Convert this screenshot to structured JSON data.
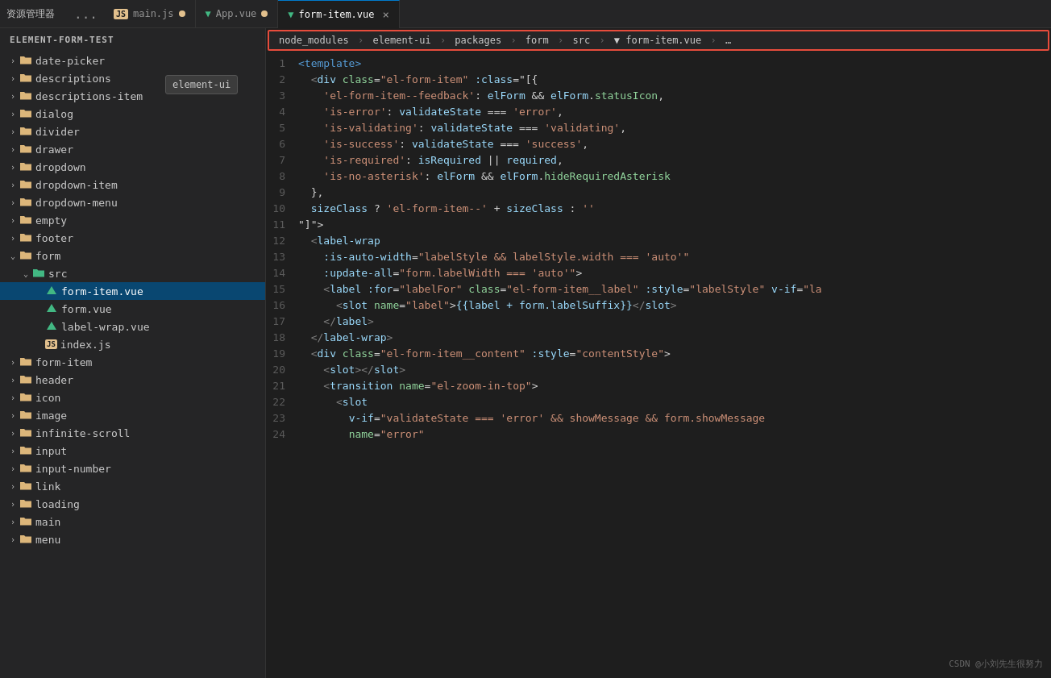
{
  "topbar": {
    "title": "资源管理器",
    "more": "...",
    "tabs": [
      {
        "id": "main-js",
        "icon": "js",
        "label": "main.js",
        "modified": true,
        "active": false
      },
      {
        "id": "app-vue",
        "icon": "vue",
        "label": "App.vue",
        "modified": true,
        "active": false
      },
      {
        "id": "form-item-vue",
        "icon": "vue",
        "label": "form-item.vue",
        "active": true,
        "closable": true
      }
    ]
  },
  "sidebar": {
    "root": "ELEMENT-FORM-TEST",
    "tooltip": "element-ui",
    "items": [
      {
        "label": "date-picker",
        "type": "folder",
        "indent": 0,
        "expanded": false
      },
      {
        "label": "descriptions",
        "type": "folder",
        "indent": 0,
        "expanded": false
      },
      {
        "label": "descriptions-item",
        "type": "folder",
        "indent": 0,
        "expanded": false
      },
      {
        "label": "dialog",
        "type": "folder",
        "indent": 0,
        "expanded": false
      },
      {
        "label": "divider",
        "type": "folder",
        "indent": 0,
        "expanded": false
      },
      {
        "label": "drawer",
        "type": "folder",
        "indent": 0,
        "expanded": false
      },
      {
        "label": "dropdown",
        "type": "folder",
        "indent": 0,
        "expanded": false
      },
      {
        "label": "dropdown-item",
        "type": "folder",
        "indent": 0,
        "expanded": false
      },
      {
        "label": "dropdown-menu",
        "type": "folder",
        "indent": 0,
        "expanded": false
      },
      {
        "label": "empty",
        "type": "folder",
        "indent": 0,
        "expanded": false
      },
      {
        "label": "footer",
        "type": "folder",
        "indent": 0,
        "expanded": false
      },
      {
        "label": "form",
        "type": "folder",
        "indent": 0,
        "expanded": true
      },
      {
        "label": "src",
        "type": "folder",
        "indent": 1,
        "expanded": true
      },
      {
        "label": "form-item.vue",
        "type": "vue-file",
        "indent": 2,
        "active": true
      },
      {
        "label": "form.vue",
        "type": "vue-file",
        "indent": 2
      },
      {
        "label": "label-wrap.vue",
        "type": "vue-file",
        "indent": 2
      },
      {
        "label": "index.js",
        "type": "js-file",
        "indent": 2
      },
      {
        "label": "form-item",
        "type": "folder",
        "indent": 0,
        "expanded": false
      },
      {
        "label": "header",
        "type": "folder",
        "indent": 0,
        "expanded": false
      },
      {
        "label": "icon",
        "type": "image-folder",
        "indent": 0,
        "expanded": false
      },
      {
        "label": "image",
        "type": "image-folder",
        "indent": 0,
        "expanded": false
      },
      {
        "label": "infinite-scroll",
        "type": "folder",
        "indent": 0,
        "expanded": false
      },
      {
        "label": "input",
        "type": "folder",
        "indent": 0,
        "expanded": false
      },
      {
        "label": "input-number",
        "type": "folder",
        "indent": 0,
        "expanded": false
      },
      {
        "label": "link",
        "type": "folder",
        "indent": 0,
        "expanded": false
      },
      {
        "label": "loading",
        "type": "folder",
        "indent": 0,
        "expanded": false
      },
      {
        "label": "main",
        "type": "folder",
        "indent": 0,
        "expanded": false
      },
      {
        "label": "menu",
        "type": "folder",
        "indent": 0,
        "expanded": false
      }
    ]
  },
  "breadcrumb": {
    "parts": [
      "node_modules",
      "element-ui",
      "packages",
      "form",
      "src",
      "form-item.vue",
      "…"
    ]
  },
  "code": {
    "lines": [
      {
        "num": 1,
        "html": "<span class='template-tag'>&lt;template&gt;</span>"
      },
      {
        "num": 2,
        "html": "  <span class='tag-bracket'>&lt;</span><span class='t'>div</span> <span class='a'>class</span><span class='op'>=</span><span class='str'>\"el-form-item\"</span> <span class='attr-bind'>:class</span><span class='op'>=\"[{</span>"
      },
      {
        "num": 3,
        "html": "    <span class='prop-name'>'el-form-item--feedback'</span><span class='op'>:</span> <span class='var'>elForm</span> <span class='bool-op'>&amp;&amp;</span> <span class='var'>elForm</span><span class='op'>.</span><span class='prop'>statusIcon</span><span class='op'>,</span>"
      },
      {
        "num": 4,
        "html": "    <span class='prop-name'>'is-error'</span><span class='op'>:</span> <span class='var'>validateState</span> <span class='bool-op'>===</span> <span class='str'>'error'</span><span class='op'>,</span>"
      },
      {
        "num": 5,
        "html": "    <span class='prop-name'>'is-validating'</span><span class='op'>:</span> <span class='var'>validateState</span> <span class='bool-op'>===</span> <span class='str'>'validating'</span><span class='op'>,</span>"
      },
      {
        "num": 6,
        "html": "    <span class='prop-name'>'is-success'</span><span class='op'>:</span> <span class='var'>validateState</span> <span class='bool-op'>===</span> <span class='str'>'success'</span><span class='op'>,</span>"
      },
      {
        "num": 7,
        "html": "    <span class='prop-name'>'is-required'</span><span class='op'>:</span> <span class='var'>isRequired</span> <span class='bool-op'>||</span> <span class='var'>required</span><span class='op'>,</span>"
      },
      {
        "num": 8,
        "html": "    <span class='prop-name'>'is-no-asterisk'</span><span class='op'>:</span> <span class='var'>elForm</span> <span class='bool-op'>&amp;&amp;</span> <span class='var'>elForm</span><span class='op'>.</span><span class='prop'>hideRequiredAsterisk</span>"
      },
      {
        "num": 9,
        "html": "  <span class='op'>},</span>"
      },
      {
        "num": 10,
        "html": "  <span class='var'>sizeClass</span> <span class='op'>?</span> <span class='str'>'el-form-item--'</span> <span class='op'>+</span> <span class='var'>sizeClass</span> <span class='op'>:</span> <span class='str'>''</span>"
      },
      {
        "num": 11,
        "html": "<span class='op'>\"]\"</span><span class='op'>&gt;</span>"
      },
      {
        "num": 12,
        "html": "  <span class='tag-bracket'>&lt;</span><span class='t'>label-wrap</span>"
      },
      {
        "num": 13,
        "html": "    <span class='attr-bind'>:is-auto-width</span><span class='op'>=</span><span class='str'>\"labelStyle &amp;&amp; labelStyle.width === 'auto'\"</span>"
      },
      {
        "num": 14,
        "html": "    <span class='attr-bind'>:update-all</span><span class='op'>=</span><span class='str'>\"form.labelWidth === 'auto'\"</span><span class='op'>&gt;</span>"
      },
      {
        "num": 15,
        "html": "    <span class='tag-bracket'>&lt;</span><span class='t'>label</span> <span class='attr-bind'>:for</span><span class='op'>=</span><span class='str'>\"labelFor\"</span> <span class='a'>class</span><span class='op'>=</span><span class='str'>\"el-form-item__label\"</span> <span class='attr-bind'>:style</span><span class='op'>=</span><span class='str'>\"labelStyle\"</span> <span class='vue-dir'>v-if</span><span class='op'>=</span><span class='str'>\"la</span>"
      },
      {
        "num": 16,
        "html": "      <span class='tag-bracket'>&lt;</span><span class='t'>slot</span> <span class='a'>name</span><span class='op'>=</span><span class='str'>\"label\"</span><span class='op'>&gt;</span><span class='interp'>{{label + form.labelSuffix}}</span><span class='tag-bracket'>&lt;/</span><span class='t'>slot</span><span class='tag-bracket'>&gt;</span>"
      },
      {
        "num": 17,
        "html": "    <span class='tag-bracket'>&lt;/</span><span class='t'>label</span><span class='tag-bracket'>&gt;</span>"
      },
      {
        "num": 18,
        "html": "  <span class='tag-bracket'>&lt;/</span><span class='t'>label-wrap</span><span class='tag-bracket'>&gt;</span>"
      },
      {
        "num": 19,
        "html": "  <span class='tag-bracket'>&lt;</span><span class='t'>div</span> <span class='a'>class</span><span class='op'>=</span><span class='str'>\"el-form-item__content\"</span> <span class='attr-bind'>:style</span><span class='op'>=</span><span class='str'>\"contentStyle\"</span><span class='op'>&gt;</span>"
      },
      {
        "num": 20,
        "html": "    <span class='tag-bracket'>&lt;</span><span class='t'>slot</span><span class='tag-bracket'>&gt;&lt;/</span><span class='t'>slot</span><span class='tag-bracket'>&gt;</span>"
      },
      {
        "num": 21,
        "html": "    <span class='tag-bracket'>&lt;</span><span class='t'>transition</span> <span class='a'>name</span><span class='op'>=</span><span class='str'>\"el-zoom-in-top\"</span><span class='op'>&gt;</span>"
      },
      {
        "num": 22,
        "html": "      <span class='tag-bracket'>&lt;</span><span class='t'>slot</span>"
      },
      {
        "num": 23,
        "html": "        <span class='vue-dir'>v-if</span><span class='op'>=</span><span class='str'>\"validateState === 'error' &amp;&amp; showMessage &amp;&amp; form.showMessage</span>"
      },
      {
        "num": 24,
        "html": "        <span class='a'>name</span><span class='op'>=</span><span class='str'>\"error\"</span>"
      }
    ]
  },
  "watermark": "CSDN @小刘先生很努力"
}
